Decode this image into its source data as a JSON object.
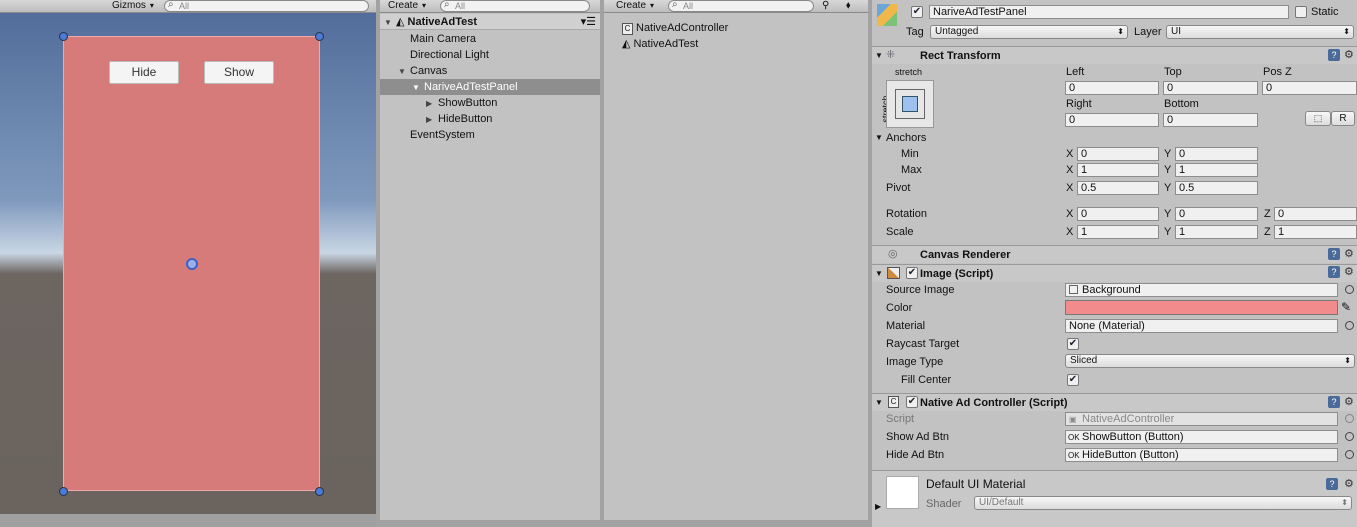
{
  "scene": {
    "gizmos_label": "Gizmos",
    "search_placeholder": "All",
    "hide_button": "Hide",
    "show_button": "Show",
    "panel_color": "#d67a7a"
  },
  "hierarchy": {
    "create_label": "Create",
    "search_placeholder": "All",
    "root": "NativeAdTest",
    "items": [
      {
        "label": "Main Camera"
      },
      {
        "label": "Directional Light"
      },
      {
        "label": "Canvas"
      },
      {
        "label": "NariveAdTestPanel"
      },
      {
        "label": "ShowButton"
      },
      {
        "label": "HideButton"
      },
      {
        "label": "EventSystem"
      }
    ]
  },
  "project": {
    "create_label": "Create",
    "search_placeholder": "All",
    "items": [
      {
        "label": "NativeAdController",
        "icon": "script-icon"
      },
      {
        "label": "NativeAdTest",
        "icon": "unity-scene-icon"
      }
    ]
  },
  "inspector": {
    "object_name": "NariveAdTestPanel",
    "static_label": "Static",
    "tag_label": "Tag",
    "tag_value": "Untagged",
    "layer_label": "Layer",
    "layer_value": "UI",
    "rect": {
      "title": "Rect Transform",
      "stretch_h": "stretch",
      "stretch_v": "stretch",
      "left_label": "Left",
      "left": "0",
      "top_label": "Top",
      "top": "0",
      "posz_label": "Pos Z",
      "posz": "0",
      "right_label": "Right",
      "right": "0",
      "bottom_label": "Bottom",
      "bottom": "0",
      "r_label": "R",
      "anchors_label": "Anchors",
      "min_label": "Min",
      "max_label": "Max",
      "min_x": "0",
      "min_y": "0",
      "max_x": "1",
      "max_y": "1",
      "pivot_label": "Pivot",
      "pivot_x": "0.5",
      "pivot_y": "0.5",
      "rotation_label": "Rotation",
      "rot_x": "0",
      "rot_y": "0",
      "rot_z": "0",
      "scale_label": "Scale",
      "scale_x": "1",
      "scale_y": "1",
      "scale_z": "1",
      "x": "X",
      "y": "Y",
      "z": "Z"
    },
    "canvas_renderer": "Canvas Renderer",
    "image": {
      "title": "Image (Script)",
      "source_label": "Source Image",
      "source": "Background",
      "color_label": "Color",
      "color": "#f28c8c",
      "material_label": "Material",
      "material": "None (Material)",
      "raycast_label": "Raycast Target",
      "type_label": "Image Type",
      "type": "Sliced",
      "fill_label": "Fill Center"
    },
    "controller": {
      "title": "Native Ad Controller (Script)",
      "script_label": "Script",
      "script": "NativeAdController",
      "show_label": "Show Ad Btn",
      "show": "ShowButton (Button)",
      "hide_label": "Hide Ad Btn",
      "hide": "HideButton (Button)"
    },
    "material": {
      "title": "Default UI Material",
      "shader_label": "Shader",
      "shader": "UI/Default"
    }
  }
}
